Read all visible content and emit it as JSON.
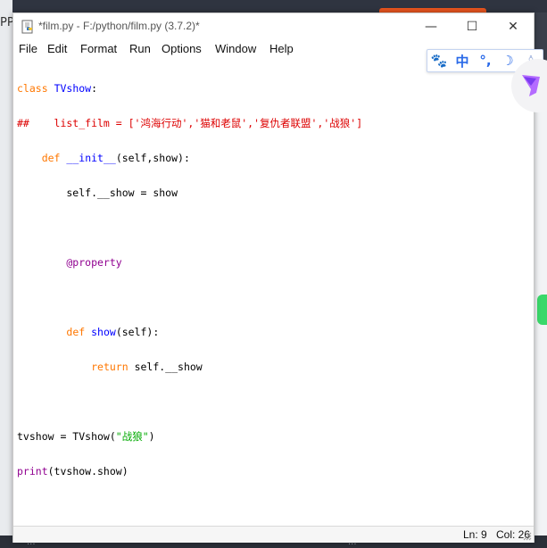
{
  "background": {
    "left_label": "PP",
    "bottom_labels": [
      "...",
      "..."
    ]
  },
  "window": {
    "title": "*film.py - F:/python/film.py (3.7.2)*",
    "controls": {
      "minimize": "—",
      "maximize": "☐",
      "close": "✕"
    }
  },
  "menu": [
    "File",
    "Edit",
    "Format",
    "Run",
    "Options",
    "Window",
    "Help"
  ],
  "code": {
    "l1_kw": "class",
    "l1_name": "TVshow",
    "l1_rest": ":",
    "l2_comment": "##    list_film = ['鸿海行动','猫和老鼠','复仇者联盟','战狼']",
    "l3_indent": "    ",
    "l3_kw": "def",
    "l3_name": "__init__",
    "l3_rest": "(self,show):",
    "l4": "        self.__show = show",
    "l5": "",
    "l6": "        @property",
    "l7": "",
    "l8_indent": "        ",
    "l8_kw": "def",
    "l8_name": "show",
    "l8_rest": "(self):",
    "l9_indent": "            ",
    "l9_kw": "return",
    "l9_rest": " self.__show",
    "l10": "",
    "l11_pre": "tvshow = TVshow(",
    "l11_str": "\"战狼\"",
    "l11_post": ")",
    "l12_blt": "print",
    "l12_rest": "(tvshow.show)"
  },
  "status": {
    "line": "Ln: 9",
    "col": "Col: 26"
  },
  "ime": {
    "paw": "🐾",
    "lang": "中",
    "punct": "°,",
    "moon": "☽",
    "user": "♙"
  },
  "colors": {
    "keyword": "#ff7700",
    "definition": "#0000ff",
    "comment": "#dd0000",
    "string": "#00aa00",
    "builtin": "#900090",
    "ime_blue": "#2a6ae8"
  }
}
